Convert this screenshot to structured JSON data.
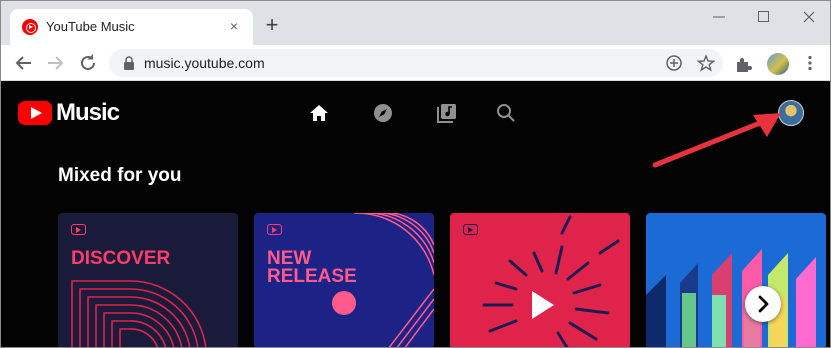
{
  "browser": {
    "tab": {
      "title": "YouTube Music",
      "close_glyph": "×"
    },
    "new_tab_glyph": "+",
    "window_controls": {
      "minimize": "minimize-icon",
      "maximize": "maximize-icon",
      "close": "close-icon"
    },
    "url": "music.youtube.com"
  },
  "app": {
    "logo_text": "Music",
    "nav": [
      "home-icon",
      "explore-icon",
      "library-icon",
      "search-icon"
    ],
    "section_title": "Mixed for you",
    "cards": [
      {
        "label": "DISCOVER"
      },
      {
        "label_line1": "NEW",
        "label_line2": "RELEASE"
      },
      {
        "label": ""
      },
      {
        "label": ""
      }
    ],
    "next_glyph": "›"
  },
  "colors": {
    "brand_red": "#ff0000",
    "annotation_arrow": "#e8323c",
    "background": "#030303"
  }
}
